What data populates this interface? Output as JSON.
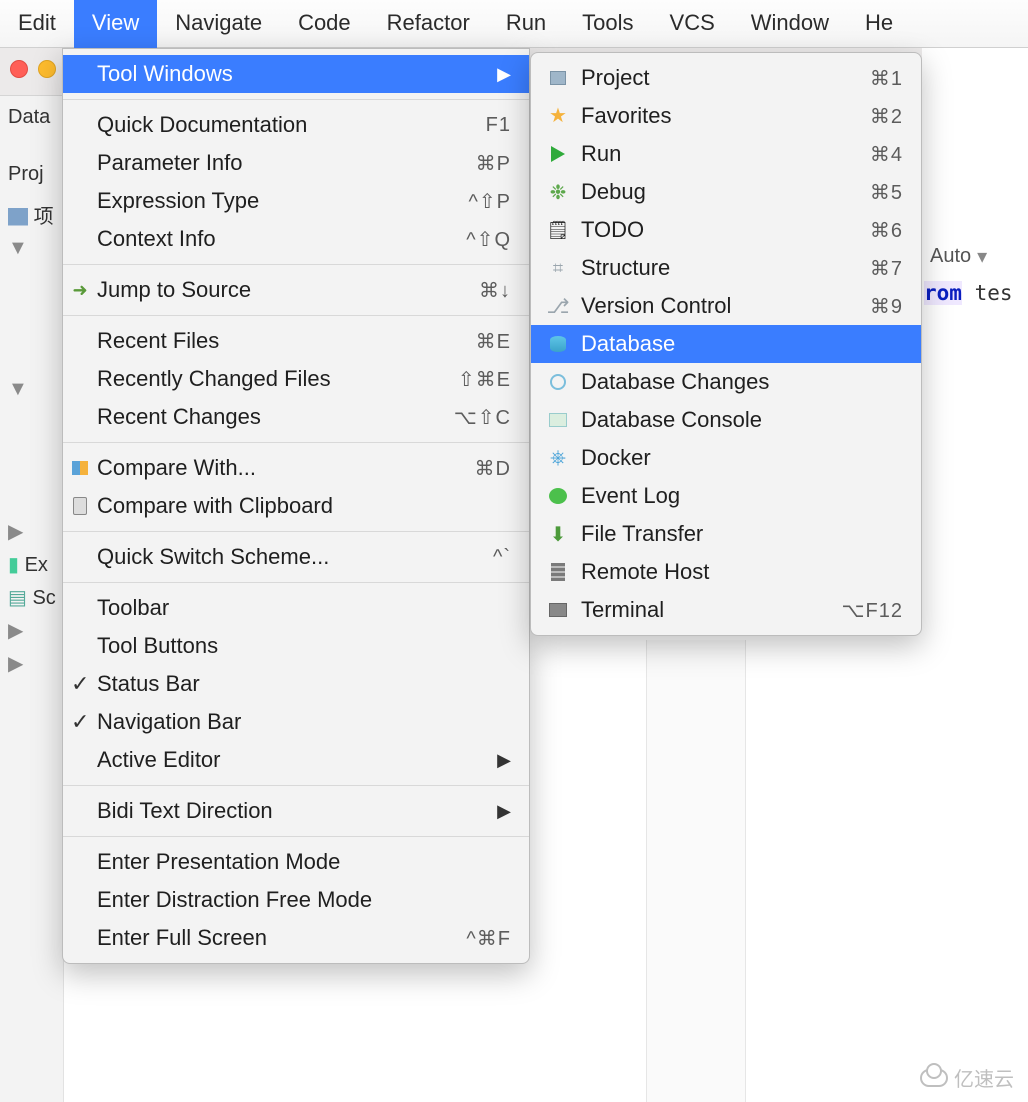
{
  "menubar": {
    "items": [
      "Edit",
      "View",
      "Navigate",
      "Code",
      "Refactor",
      "Run",
      "Tools",
      "VCS",
      "Window",
      "He"
    ],
    "active_index": 1
  },
  "left_strip": {
    "rows": [
      "Data",
      "Proj",
      "项",
      "",
      "",
      "",
      "",
      "Ex",
      "Sc"
    ]
  },
  "view_menu": {
    "groups": [
      [
        {
          "label": "Tool Windows",
          "shortcut": "",
          "submenu": true,
          "highlight": true
        }
      ],
      [
        {
          "label": "Quick Documentation",
          "shortcut": "F1"
        },
        {
          "label": "Parameter Info",
          "shortcut": "⌘P"
        },
        {
          "label": "Expression Type",
          "shortcut": "^⇧P"
        },
        {
          "label": "Context Info",
          "shortcut": "^⇧Q"
        }
      ],
      [
        {
          "label": "Jump to Source",
          "shortcut": "⌘↓",
          "icon": "jump"
        }
      ],
      [
        {
          "label": "Recent Files",
          "shortcut": "⌘E"
        },
        {
          "label": "Recently Changed Files",
          "shortcut": "⇧⌘E"
        },
        {
          "label": "Recent Changes",
          "shortcut": "⌥⇧C"
        }
      ],
      [
        {
          "label": "Compare With...",
          "shortcut": "⌘D",
          "icon": "cmp"
        },
        {
          "label": "Compare with Clipboard",
          "shortcut": "",
          "icon": "clip"
        }
      ],
      [
        {
          "label": "Quick Switch Scheme...",
          "shortcut": "^`"
        }
      ],
      [
        {
          "label": "Toolbar"
        },
        {
          "label": "Tool Buttons"
        },
        {
          "label": "Status Bar",
          "checked": true
        },
        {
          "label": "Navigation Bar",
          "checked": true
        },
        {
          "label": "Active Editor",
          "submenu": true
        }
      ],
      [
        {
          "label": "Bidi Text Direction",
          "submenu": true
        }
      ],
      [
        {
          "label": "Enter Presentation Mode"
        },
        {
          "label": "Enter Distraction Free Mode"
        },
        {
          "label": "Enter Full Screen",
          "shortcut": "^⌘F"
        }
      ]
    ]
  },
  "tool_windows_submenu": {
    "items": [
      {
        "label": "Project",
        "shortcut": "⌘1",
        "icon": "square"
      },
      {
        "label": "Favorites",
        "shortcut": "⌘2",
        "icon": "star"
      },
      {
        "label": "Run",
        "shortcut": "⌘4",
        "icon": "play"
      },
      {
        "label": "Debug",
        "shortcut": "⌘5",
        "icon": "bug"
      },
      {
        "label": "TODO",
        "shortcut": "⌘6",
        "icon": "todo"
      },
      {
        "label": "Structure",
        "shortcut": "⌘7",
        "icon": "struct"
      },
      {
        "label": "Version Control",
        "shortcut": "⌘9",
        "icon": "vcs"
      },
      {
        "label": "Database",
        "shortcut": "",
        "icon": "db",
        "highlight": true
      },
      {
        "label": "Database Changes",
        "shortcut": "",
        "icon": "dbch"
      },
      {
        "label": "Database Console",
        "shortcut": "",
        "icon": "dbcon"
      },
      {
        "label": "Docker",
        "shortcut": "",
        "icon": "dock"
      },
      {
        "label": "Event Log",
        "shortcut": "",
        "icon": "chat"
      },
      {
        "label": "File Transfer",
        "shortcut": "",
        "icon": "ft"
      },
      {
        "label": "Remote Host",
        "shortcut": "",
        "icon": "host"
      },
      {
        "label": "Terminal",
        "shortcut": "⌥F12",
        "icon": "term"
      }
    ]
  },
  "right": {
    "auto_label": "Auto",
    "code_kw": "rom",
    "code_rest": " tes"
  },
  "watermark": "亿速云"
}
